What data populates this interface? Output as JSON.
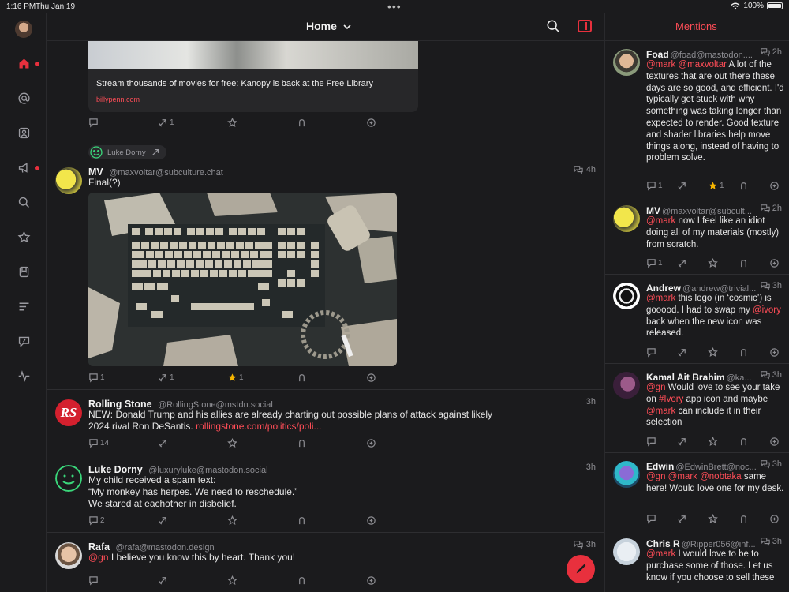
{
  "status": {
    "time": "1:16 PM",
    "date": "Thu Jan 19",
    "battery": "100%"
  },
  "topbar": {
    "title": "Home"
  },
  "colors": {
    "accent": "#e8303d",
    "mention": "#ff4d57",
    "background": "#1b1b1d",
    "star": "#f5b400"
  },
  "rail": {
    "icons": [
      "home-icon",
      "at-icon",
      "profile-icon",
      "megaphone-icon",
      "search-icon",
      "star-icon",
      "bookmark-icon",
      "list-icon",
      "message-icon",
      "activity-icon"
    ]
  },
  "feed": {
    "post0": {
      "card_title": "Stream thousands of movies for free: Kanopy is back at the Free Library",
      "card_domain": "billypenn.com",
      "boosts": "1"
    },
    "post1": {
      "boosted_by": "Luke Dorny",
      "name": "MV",
      "handle": "@maxvoltar@subculture.chat",
      "time": "4h",
      "text": "Final(?)",
      "replies": "1",
      "boosts": "1",
      "favs": "1"
    },
    "post2": {
      "name": "Rolling Stone",
      "handle": "@RollingStone@mstdn.social",
      "time": "3h",
      "text": "NEW: Donald Trump and his allies are already charting out possible plans of attack against likely 2024 rival Ron DeSantis.",
      "link": "rollingstone.com/politics/poli...",
      "replies": "14"
    },
    "post3": {
      "name": "Luke Dorny",
      "handle": "@luxuryluke@mastodon.social",
      "time": "3h",
      "line1": "My child received a spam text:",
      "line2": "“My monkey has herpes. We need to reschedule.”",
      "line3": "We stared at eachother in disbelief.",
      "replies": "2"
    },
    "post4": {
      "name": "Rafa",
      "handle": "@rafa@mastodon.design",
      "time": "3h",
      "mention": "@gn",
      "text": "I believe you know this by heart. Thank you!"
    }
  },
  "mentions": {
    "title": "Mentions",
    "items": [
      {
        "name": "Foad",
        "handle": "@foad@mastodon....",
        "time": "2h",
        "m1": "@mark",
        "m2": "@maxvoltar",
        "text": "A lot of the textures that are out there these days are so good, and efficient. I'd typically get stuck with why something was taking longer than expected to render. Good texture and shader libraries help move things along, instead of having to problem solve.",
        "replies": "1",
        "favs": "1"
      },
      {
        "name": "MV",
        "handle": "@maxvoltar@subcult...",
        "time": "2h",
        "m1": "@mark",
        "text": "now I feel like an idiot doing all of my materials (mostly) from scratch.",
        "replies": "1"
      },
      {
        "name": "Andrew",
        "handle": "@andrew@trivial...",
        "time": "3h",
        "m1": "@mark",
        "text1": "this logo (in ‘cosmic’) is gooood. I had to swap my",
        "m2": "@ivory",
        "text2": "back when the new icon was released."
      },
      {
        "name": "Kamal Ait Brahim",
        "handle": "@ka...",
        "time": "3h",
        "m1": "@gn",
        "text1": "Would love to see your take on",
        "m2": "#Ivory",
        "text2": "app icon and maybe",
        "m3": "@mark",
        "text3": "can include it in their selection"
      },
      {
        "name": "Edwin",
        "handle": "@EdwinBrett@noc...",
        "time": "3h",
        "m1": "@gn",
        "m2": "@mark",
        "m3": "@nobtaka",
        "text": "same here! Would love one for my desk."
      },
      {
        "name": "Chris R",
        "handle": "@Ripper056@inf...",
        "time": "3h",
        "m1": "@mark",
        "text": "I would love to be to purchase some of those.  Let us know if you choose to sell these"
      }
    ]
  }
}
